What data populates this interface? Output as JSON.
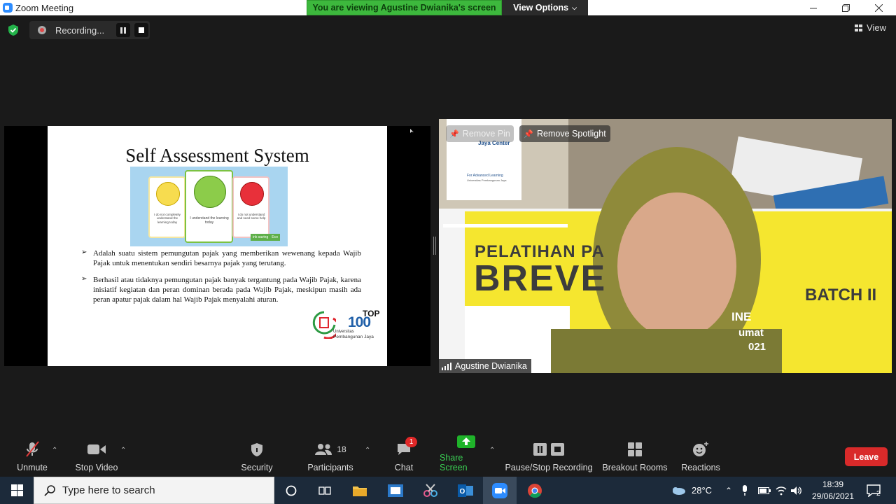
{
  "window": {
    "title": "Zoom Meeting",
    "controls": [
      "minimize",
      "restore",
      "close"
    ]
  },
  "share_banner": {
    "text": "You are viewing Agustine Dwianika's screen",
    "options_label": "View Options"
  },
  "recording": {
    "label": "Recording..."
  },
  "view_label": "View",
  "slide": {
    "title": "Self Assessment System",
    "cards": [
      {
        "text": "I do not completely understand the learning today"
      },
      {
        "text": "I understand the learning today"
      },
      {
        "text": "I do not understand and need some help"
      }
    ],
    "card_tag_left": "ink saving",
    "card_tag_right": "Eco",
    "bullets": [
      "Adalah suatu sistem pemungutan pajak yang memberikan wewenang kepada Wajib Pajak untuk menentukan sendiri besarnya pajak yang terutang.",
      "Berhasil atau tidaknya pemungutan pajak banyak tergantung pada Wajib Pajak, karena inisiatif kegiatan dan peran dominan berada pada Wajib Pajak, meskipun masih ada peran apatur pajak dalam hal Wajib Pajak menyalahi aturan."
    ],
    "logo_top": "TOP",
    "logo_num": "100",
    "logo_line1": "Universitas",
    "logo_line2": "Pembangunan Jaya"
  },
  "video": {
    "remove_pin": "Remove Pin",
    "remove_spotlight": "Remove Spotlight",
    "participant_name": "Agustine Dwianika",
    "bg_logo_name": "Jaya Center",
    "bg_logo_sub": "For Advanced Learning",
    "bg_logo_univ": "Universitas Pembangunan Jaya",
    "bg_pelatihan": "PELATIHAN PA",
    "bg_brevet": "BREVE",
    "bg_batch": "BATCH II",
    "bg_line1": "INE",
    "bg_line2": "umat",
    "bg_line3": "021"
  },
  "toolbar": {
    "unmute": "Unmute",
    "stop_video": "Stop Video",
    "security": "Security",
    "participants": "Participants",
    "participants_count": "18",
    "chat": "Chat",
    "chat_badge": "1",
    "share_screen": "Share Screen",
    "pause_stop_recording": "Pause/Stop Recording",
    "breakout_rooms": "Breakout Rooms",
    "reactions": "Reactions",
    "leave": "Leave"
  },
  "taskbar": {
    "search_placeholder": "Type here to search",
    "temperature": "28°C",
    "time": "18:39",
    "date": "29/06/2021",
    "notification_count": "2"
  },
  "colors": {
    "share_green": "#3db83d",
    "leave_red": "#d92a2a",
    "share_icon_green": "#1fb32a"
  }
}
